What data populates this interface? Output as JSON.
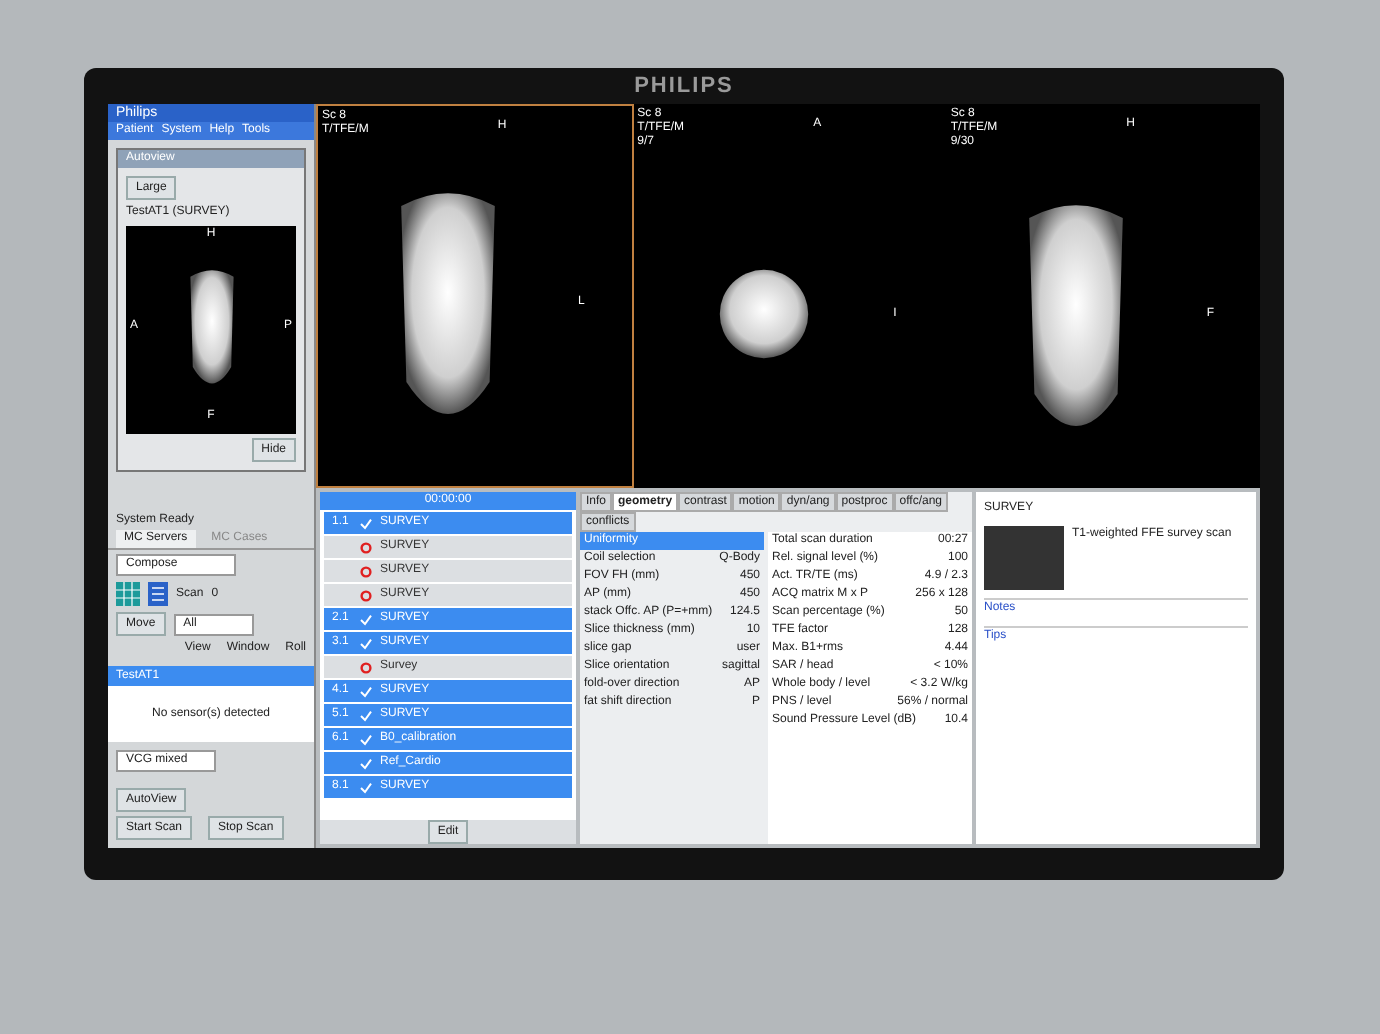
{
  "monitor": {
    "brand": "PHILIPS"
  },
  "app": {
    "title": "Philips",
    "menu": [
      "Patient",
      "System",
      "Help",
      "Tools"
    ]
  },
  "autoview": {
    "title": "Autoview",
    "size_button": "Large",
    "caption": "TestAT1 (SURVEY)",
    "labels": {
      "top": "H",
      "left": "A",
      "right": "P",
      "bottom": "F"
    },
    "hide_button": "Hide"
  },
  "viewports": [
    {
      "kind": "tall",
      "info": [
        "Sc 8",
        "T/TFE/M"
      ],
      "top_label": "H",
      "side_label": "L"
    },
    {
      "kind": "round",
      "info": [
        "Sc 8",
        "T/TFE/M",
        "9/7"
      ],
      "top_label": "A",
      "side_label": "I"
    },
    {
      "kind": "tall",
      "info": [
        "Sc 8",
        "T/TFE/M",
        "9/30"
      ],
      "top_label": "H",
      "side_label": "F"
    }
  ],
  "status": "System Ready",
  "controls": {
    "servers_tab": "MC Servers",
    "cases_tab": "MC Cases",
    "compose": "Compose",
    "scan_label": "Scan",
    "scan_value": "0",
    "move_button": "Move",
    "move_value": "All",
    "view_labels": [
      "View",
      "Window",
      "Roll"
    ]
  },
  "patient": {
    "name": "TestAT1",
    "message": "No sensor(s) detected",
    "vcg": "VCG mixed"
  },
  "buttons": {
    "autoview": "AutoView",
    "start": "Start Scan",
    "stop": "Stop Scan"
  },
  "scanlist": {
    "time": "00:00:00",
    "footer": "Edit",
    "rows": [
      {
        "number": "1.1",
        "name": "SURVEY",
        "done": true
      },
      {
        "name": "SURVEY",
        "done": false
      },
      {
        "name": "SURVEY",
        "done": false
      },
      {
        "name": "SURVEY",
        "done": false
      },
      {
        "number": "2.1",
        "name": "SURVEY",
        "done": true
      },
      {
        "number": "3.1",
        "name": "SURVEY",
        "done": true
      },
      {
        "name": "Survey",
        "done": false
      },
      {
        "number": "4.1",
        "name": "SURVEY",
        "done": true
      },
      {
        "number": "5.1",
        "name": "SURVEY",
        "done": true
      },
      {
        "number": "6.1",
        "name": "B0_calibration",
        "done": true
      },
      {
        "name": "Ref_Cardio",
        "done": true
      },
      {
        "number": "8.1",
        "name": "SURVEY",
        "done": true
      }
    ]
  },
  "params": {
    "tabs": [
      {
        "label": "Info",
        "selected": false
      },
      {
        "label": "geometry",
        "selected": true
      },
      {
        "label": "contrast",
        "selected": false
      },
      {
        "label": "motion",
        "selected": false
      },
      {
        "label": "dyn/ang",
        "selected": false
      },
      {
        "label": "postproc",
        "selected": false
      },
      {
        "label": "offc/ang",
        "selected": false
      },
      {
        "label": "conflicts",
        "selected": false
      }
    ],
    "left": [
      {
        "label": "Uniformity",
        "selected": true
      },
      {
        "label": "Coil selection",
        "value": "Q-Body",
        "selected": false
      },
      {
        "label": "FOV FH (mm)",
        "value": "450",
        "selected": false
      },
      {
        "label": "AP (mm)",
        "value": "450",
        "selected": false
      },
      {
        "label": "stack Offc. AP (P=+mm)",
        "value": "124.5",
        "selected": false
      },
      {
        "label": "Slice thickness (mm)",
        "value": "10",
        "selected": false
      },
      {
        "label": "slice gap",
        "value": "user",
        "selected": false
      },
      {
        "label": "Slice orientation",
        "value": "sagittal",
        "selected": false
      },
      {
        "label": "fold-over direction",
        "value": "AP",
        "selected": false
      },
      {
        "label": "fat shift direction",
        "value": "P",
        "selected": false
      }
    ],
    "right": [
      {
        "label": "Total scan duration",
        "value": "00:27"
      },
      {
        "label": "Rel. signal level (%)",
        "value": "100"
      },
      {
        "label": "Act. TR/TE (ms)",
        "value": "4.9 / 2.3"
      },
      {
        "label": "ACQ matrix M x P",
        "value": "256 x 128"
      },
      {
        "label": "Scan percentage (%)",
        "value": "50"
      },
      {
        "label": "TFE factor",
        "value": "128"
      },
      {
        "label": "Max. B1+rms",
        "value": "4.44"
      },
      {
        "label": "SAR / head",
        "value": "< 10%"
      },
      {
        "label": "Whole body / level",
        "value": "< 3.2 W/kg"
      },
      {
        "label": "PNS / level",
        "value": "56% / normal"
      },
      {
        "label": "Sound Pressure Level (dB)",
        "value": "10.4"
      }
    ]
  },
  "info": {
    "title": "SURVEY",
    "heading": "T1-weighted FFE survey scan",
    "notes_title": "Notes",
    "tips_title": "Tips"
  }
}
